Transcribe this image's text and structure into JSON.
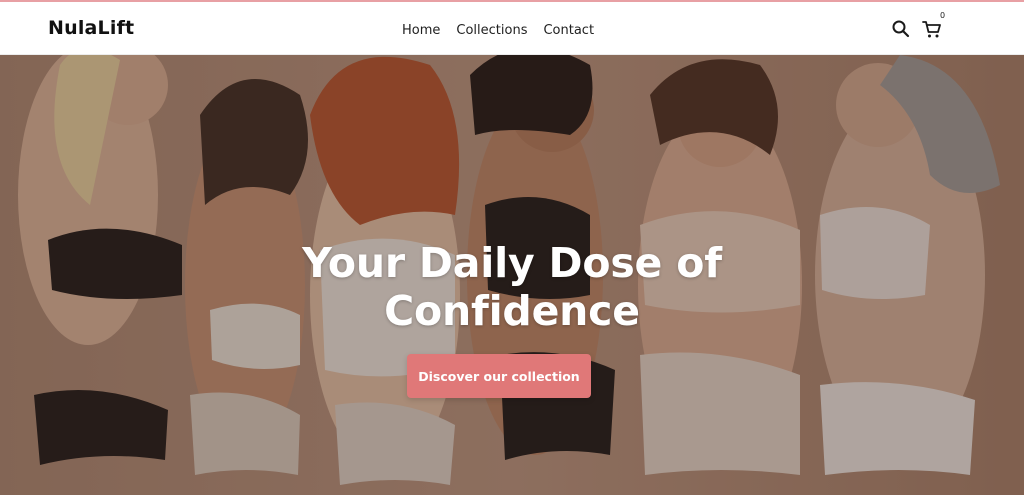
{
  "brand": {
    "name": "NulaLift",
    "accent": "#e07878"
  },
  "nav": {
    "items": [
      {
        "label": "Home"
      },
      {
        "label": "Collections"
      },
      {
        "label": "Contact"
      }
    ]
  },
  "header_icons": {
    "search": "search-icon",
    "cart": "cart-icon",
    "cart_count": "0"
  },
  "hero": {
    "title_line1": "Your Daily Dose of",
    "title_line2": "Confidence",
    "cta_label": "Discover our collection",
    "image": "group of smiling women in lingerie against a warm beige backdrop"
  }
}
